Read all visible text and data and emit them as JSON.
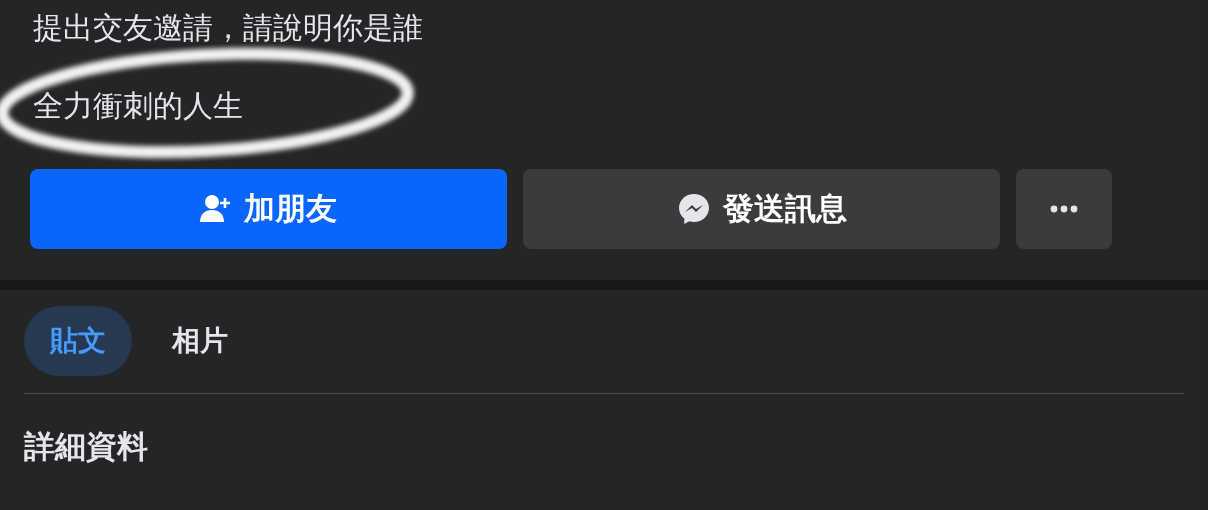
{
  "intro": [
    {
      "text": "提出交友邀請，請說明你是誰"
    },
    {
      "text": "全力衝刺的人生"
    }
  ],
  "actions": [
    {
      "kind": "add-friend",
      "label": "加朋友"
    },
    {
      "kind": "message",
      "label": "發送訊息"
    },
    {
      "kind": "more"
    }
  ],
  "tabs": [
    {
      "label": "貼文",
      "selected": true
    },
    {
      "label": "相片",
      "selected": false
    }
  ],
  "section_title": "詳細資料"
}
